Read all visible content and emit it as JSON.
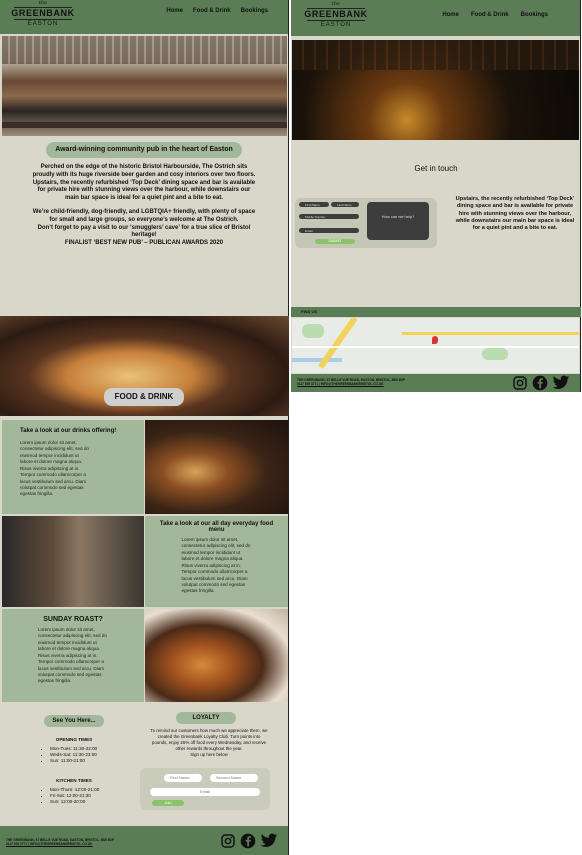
{
  "brand": {
    "the": "the",
    "name": "GREENBANK",
    "sub": "EASTON"
  },
  "nav": {
    "home": "Home",
    "food_drink": "Food & Drink",
    "bookings": "Bookings"
  },
  "home": {
    "award": "Award-winning community pub in the heart of Easton",
    "p1": "Perched on the edge of the historic Bristol Harbourside, The Ostrich sits proudly with its huge riverside beer garden and cosy interiors over two floors.",
    "p2": "Upstairs, the recently refurbished ‘Top Deck’ dining space and bar is available for private hire with stunning views over the harbour, while downstairs our main bar space is ideal for a quiet pint and a bite to eat.",
    "p3": "We’re child-friendly, dog-friendly, and LGBTQIA+ friendly, with plenty of space for small and large groups, so everyone’s welcome at The Ostrich.",
    "p4": "Don’t forget to pay a visit to our ‘smugglers’ cave’ for a true slice of Bristol heritage!",
    "p5": "FINALIST ‘BEST NEW PUB’ – PUBLICAN AWARDS 2020"
  },
  "food": {
    "title": "FOOD & DRINK",
    "drinks_title": "Take a look at our drinks offering!",
    "lorem": "Lorem ipsum dolor sit amet, consectetur adipiscing elit, sed do eiusmod tempor incididunt ut labore et dolore magna aliqua. Risus viverra adipiscing at in. Tempor commodo ullamcorper a lacus vestibulum sed arcu. Diam volutpat commodo sed egestas egestas fringilla.",
    "menu_title": "Take a look at our all day everyday food menu",
    "roast_title": "SUNDAY ROAST?"
  },
  "see_you": {
    "title": "See You Here...",
    "opening_title": "OPENING TIMES",
    "opening": [
      "Mon-Tues: 11:30-22:00",
      "Weds-Sat: 11:30-23:00",
      "Sun: 11:00-21:00"
    ],
    "kitchen_title": "KITCHEN TIMES",
    "kitchen": [
      "Mon-Thurs: 12:00-21:00",
      "Fri-Sat: 12:00-21:30",
      "Sun: 12:00-20:00"
    ]
  },
  "loyalty": {
    "title": "LOYALTY",
    "text": "To remind our customers how much we appreciate them, we created the Greenbank Loyalty Club. Turn points into pounds, enjoy 25% off food every Wednesday, and receive other rewards throughout the year.",
    "signup": "Sign up here below",
    "first_name": "First Name",
    "second_name": "Second Name",
    "email": "Email",
    "join": "Join"
  },
  "footer": {
    "address": "THE GREENBANK, 57 BELLE VUE ROAD, EASTON, BRISTOL, BS5 6DP",
    "contact": "0117 939 3771 | INFO@THEGREENBANKBRISTOL.CO.UK"
  },
  "contact": {
    "title": "Get in touch",
    "f1": "First Name",
    "f2": "Last Name",
    "f3": "Mobile Number",
    "f4": "Email",
    "message": "How can we help?",
    "submit": "SUBMIT",
    "side_text": "Upstairs, the recently refurbished ‘Top Deck’ dining space and bar is available for private hire with stunning views over the harbour, while downstairs our main bar space is ideal for a quiet pint and a bite to eat.",
    "find_us": "FIND US"
  },
  "colors": {
    "green": "#5b7d56",
    "sage": "#a3b89a",
    "cream": "#d9d7c9"
  }
}
